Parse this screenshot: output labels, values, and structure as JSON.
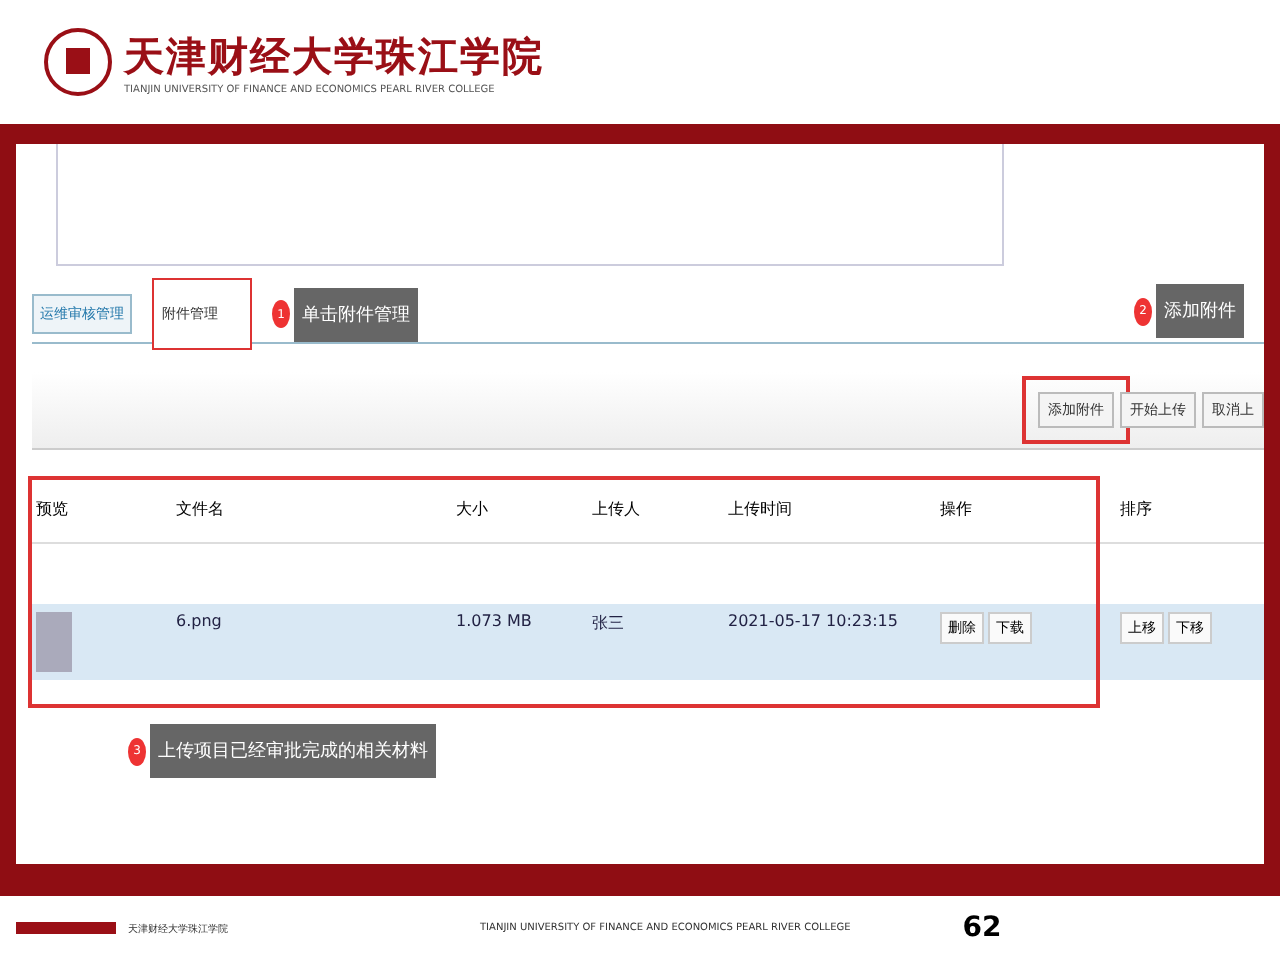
{
  "header": {
    "title": "天津财经大学珠江学院",
    "subtitle": "TIANJIN UNIVERSITY OF FINANCE AND ECONOMICS PEARL RIVER COLLEGE"
  },
  "tabs": [
    {
      "label": "运维审核管理",
      "selected": false
    },
    {
      "label": "附件管理",
      "selected": true
    }
  ],
  "callouts": [
    {
      "number": "1",
      "text": "单击附件管理"
    },
    {
      "number": "2",
      "text": "添加附件"
    },
    {
      "number": "3",
      "text": "上传项目已经审批完成的相关材料"
    }
  ],
  "toolbar": {
    "buttons": [
      "添加附件",
      "开始上传",
      "取消上"
    ]
  },
  "table": {
    "columns": [
      "预览",
      "文件名",
      "大小",
      "上传人",
      "上传时间",
      "操作",
      "排序"
    ],
    "rows": [
      {
        "file": "6.png",
        "size": "1.073 MB",
        "uploader": "张三",
        "time": "2021-05-17 10:23:15",
        "actions": [
          "删除",
          "下载"
        ],
        "order": [
          "上移",
          "下移"
        ]
      }
    ]
  },
  "footer": {
    "cn": "天津财经大学珠江学院",
    "en": "TIANJIN UNIVERSITY OF FINANCE AND ECONOMICS PEARL RIVER COLLEGE",
    "page": "62"
  }
}
